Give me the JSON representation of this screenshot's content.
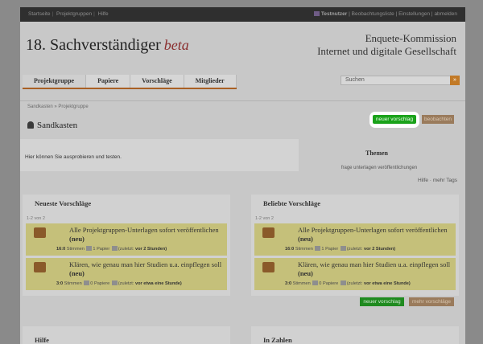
{
  "nav": {
    "links": [
      "Startseite",
      "Projektgruppen",
      "Hilfe"
    ],
    "user": "Testnutzer",
    "right_links": [
      "Beobachtungsliste",
      "Einstellungen",
      "abmelden"
    ]
  },
  "header": {
    "brand": "18. Sachverständiger",
    "beta": "beta",
    "commission_line1": "Enquete-Kommission",
    "commission_line2": "Internet und digitale Gesellschaft"
  },
  "tabs": [
    "Projektgruppe",
    "Papiere",
    "Vorschläge",
    "Mitglieder"
  ],
  "search": {
    "placeholder": "Suchen",
    "button": "»"
  },
  "breadcrumb": "Sandkasten » Projektgruppe",
  "page_title": "Sandkasten",
  "buttons": {
    "new_proposal": "neuer vorschlag",
    "watch": "beobachten",
    "new_proposal_bottom": "neuer vorschlag",
    "more_proposals": "mehr vorschläge"
  },
  "intro": "Hier können Sie ausprobieren und testen.",
  "themen": {
    "heading": "Themen",
    "tags": "frage unterlagen veröffentlichungen",
    "links": "Hilfe · mehr Tags"
  },
  "newest": {
    "heading": "Neueste Vorschläge",
    "range": "1-2 von 2",
    "items": [
      {
        "title": "Alle Projektgruppen-Unterlagen sofort veröffentlichen",
        "badge": "(neu)",
        "score": "16:0",
        "votes_label": "Stimmen",
        "papers": "1 Papier",
        "latest_label": "(zuletzt:",
        "latest": "vor 2 Stunden)"
      },
      {
        "title": "Klären, wie genau man hier Studien u.a. einpflegen soll",
        "badge": "(neu)",
        "score": "3:0",
        "votes_label": "Stimmen",
        "papers": "0 Papiere",
        "latest_label": "(zuletzt:",
        "latest": "vor etwa eine Stunde)"
      }
    ]
  },
  "popular": {
    "heading": "Beliebte Vorschläge",
    "range": "1-2 von 2",
    "items": [
      {
        "title": "Alle Projektgruppen-Unterlagen sofort veröffentlichen",
        "badge": "(neu)",
        "score": "16:0",
        "votes_label": "Stimmen",
        "papers": "1 Papier",
        "latest_label": "(zuletzt:",
        "latest": "vor 2 Stunden)"
      },
      {
        "title": "Klären, wie genau man hier Studien u.a. einpflegen soll",
        "badge": "(neu)",
        "score": "3:0",
        "votes_label": "Stimmen",
        "papers": "0 Papiere",
        "latest_label": "(zuletzt:",
        "latest": "vor etwa eine Stunde)"
      }
    ]
  },
  "bottom": {
    "help": "Hilfe",
    "numbers": "In Zahlen"
  },
  "colors": {
    "accent_green": "#1aa21a",
    "brand_beta": "#8a2e2e",
    "tab_underline": "#a86024"
  }
}
